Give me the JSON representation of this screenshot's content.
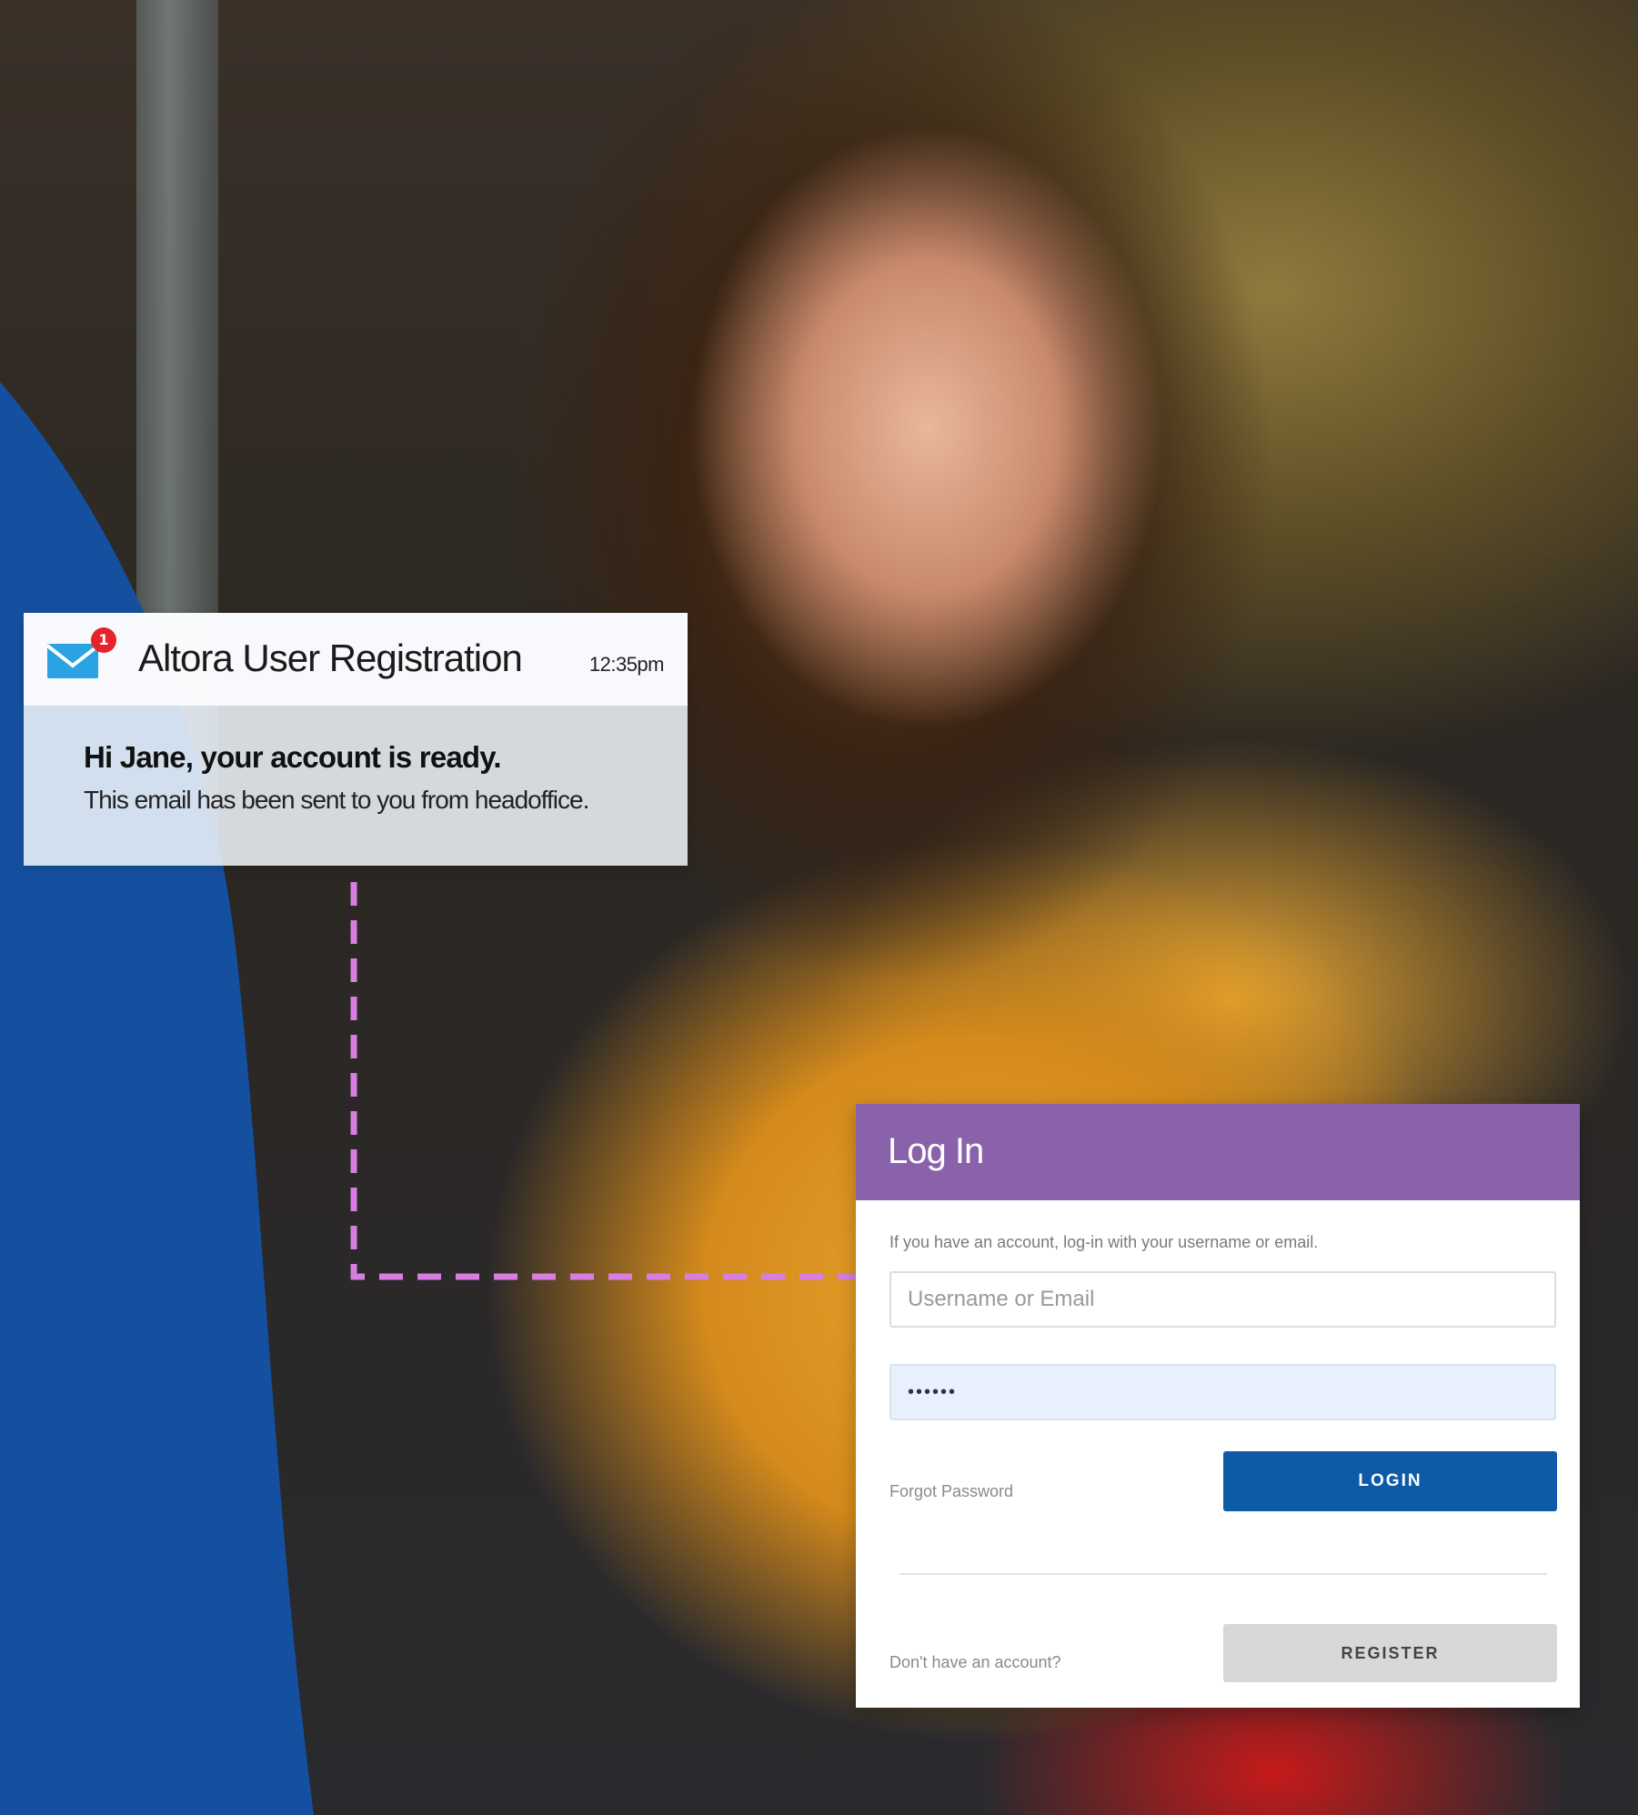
{
  "notification": {
    "app_name": "Altora User Registration",
    "time": "12:35pm",
    "badge_count": "1",
    "title": "Hi Jane, your account is ready.",
    "body": "This email has been sent to you from headoffice."
  },
  "login": {
    "title": "Log In",
    "intro": "If you have an account, log-in with your username or email.",
    "username_placeholder": "Username or Email",
    "password_value": "••••••",
    "forgot_label": "Forgot Password",
    "login_label": "LOGIN",
    "no_account_label": "Don't have an account?",
    "register_label": "REGISTER"
  },
  "colors": {
    "accent_blue": "#0d5aa7",
    "header_purple": "#8962ab",
    "badge_red": "#e8242a",
    "curve_blue": "#1550a0",
    "connector_pink": "#d77ee0"
  },
  "icons": {
    "mail": "envelope-icon"
  }
}
